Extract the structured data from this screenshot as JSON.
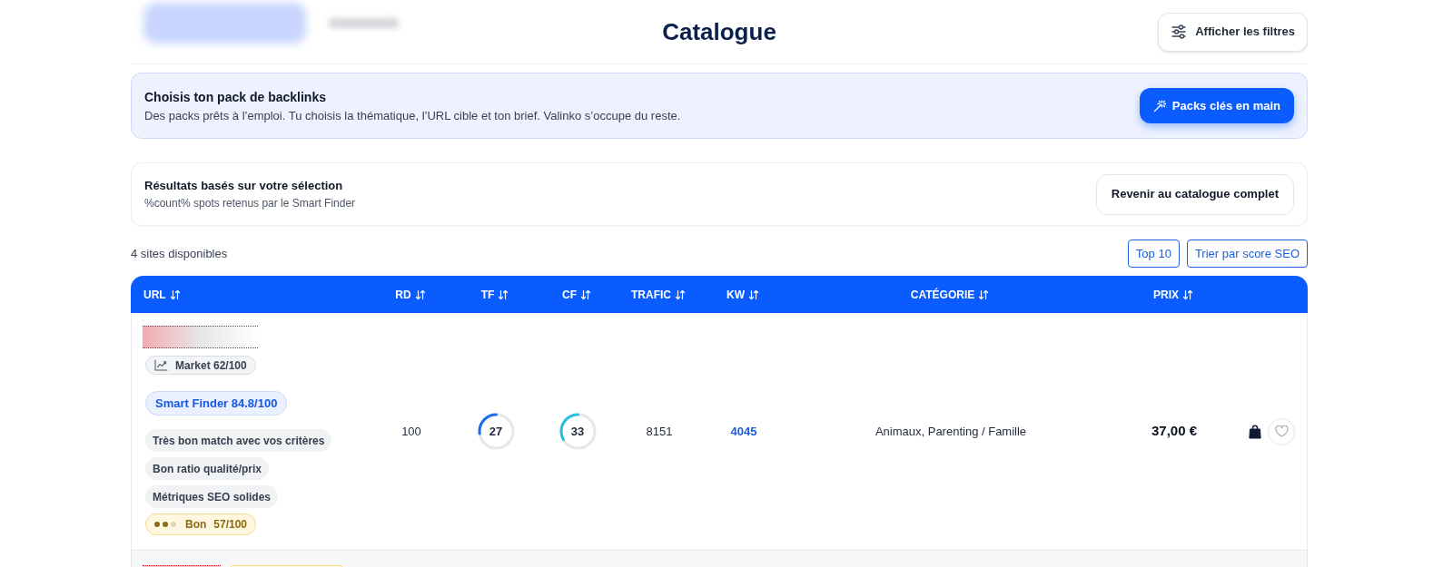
{
  "header": {
    "title": "Catalogue",
    "filters_button": "Afficher les filtres"
  },
  "pack_banner": {
    "title": "Choisis ton pack de backlinks",
    "description": "Des packs prêts à l’emploi. Tu choisis la thématique, l’URL cible et ton brief. Valinko s’occupe du reste.",
    "button": "Packs clés en main"
  },
  "selection_card": {
    "title": "Résultats basés sur votre sélection",
    "subtitle": "%count% spots retenus par le Smart Finder",
    "button": "Revenir au catalogue complet"
  },
  "results_count": "4 sites disponibles",
  "sort_buttons": [
    "Top 10",
    "Trier par score SEO"
  ],
  "table": {
    "columns": [
      "URL",
      "RD",
      "TF",
      "CF",
      "TRAFIC",
      "KW",
      "CATÉGORIE",
      "PRIX"
    ],
    "rows": [
      {
        "market": "Market 62/100",
        "smart_finder": "Smart Finder 84.8/100",
        "reasons": [
          "Très bon match avec vos critères",
          "Bon ratio qualité/prix",
          "Métriques SEO solides"
        ],
        "quality": {
          "label": "Bon",
          "score": "57/100",
          "stars": 2
        },
        "rd": "100",
        "tf": {
          "value": "27",
          "level": 0.27
        },
        "cf": {
          "value": "33",
          "level": 0.33
        },
        "trafic": "8151",
        "kw": "4045",
        "category": "Animaux, Parenting / Famille",
        "price": "37,00 €",
        "favorite": false
      }
    ]
  }
}
